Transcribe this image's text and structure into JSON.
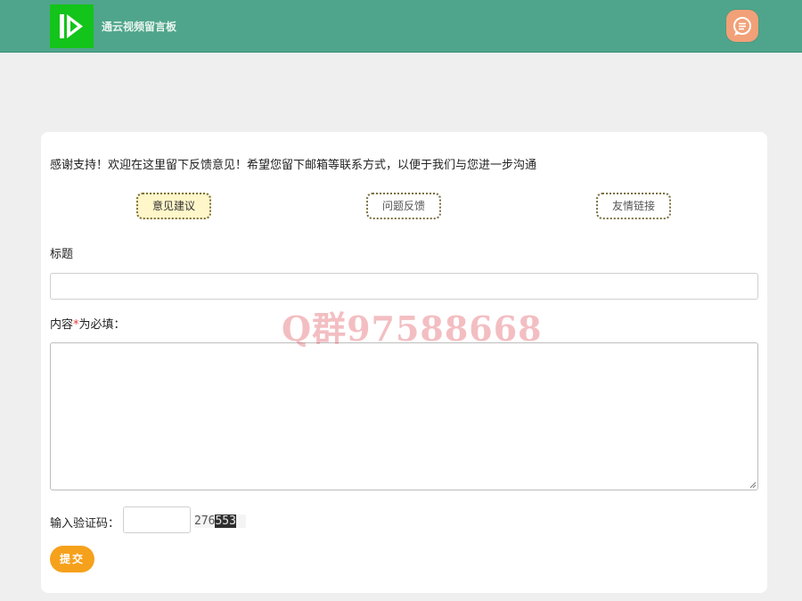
{
  "header": {
    "brand": "通云视频留言板",
    "logo_icon": "play-logo-icon",
    "chat_icon": "chat-bubble-icon",
    "colors": {
      "bar": "#4fa58b",
      "logo": "#13c41a",
      "chat": "#f2a078"
    }
  },
  "form": {
    "intro": "感谢支持！欢迎在这里留下反馈意见！希望您留下邮箱等联系方式，以便于我们与您进一步沟通",
    "tabs": [
      {
        "label": "意见建议",
        "active": true
      },
      {
        "label": "问题反馈",
        "active": false
      },
      {
        "label": "友情链接",
        "active": false
      }
    ],
    "title_label": "标题",
    "title_value": "",
    "content_label_prefix": "内容",
    "content_label_star": "*",
    "content_label_suffix": "为必填：",
    "content_value": "",
    "captcha_label": "输入验证码：",
    "captcha_value": "",
    "captcha_code_plain": "276",
    "captcha_code_noisy": "553",
    "submit_label": "提交",
    "submit_color": "#f6a11c"
  },
  "watermark": "Q群97588668"
}
